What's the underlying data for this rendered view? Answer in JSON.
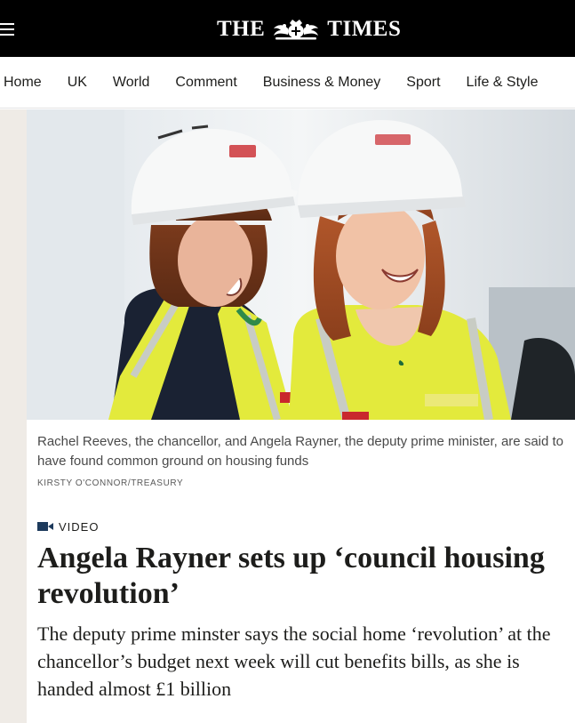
{
  "header": {
    "logo_left": "THE",
    "logo_right": "TIMES",
    "menu_icon": "hamburger-menu-icon",
    "background": "#000000"
  },
  "nav": {
    "items": [
      "Home",
      "UK",
      "World",
      "Comment",
      "Business & Money",
      "Sport",
      "Life & Style"
    ]
  },
  "article": {
    "image": {
      "description_icon": "hero-photo"
    },
    "caption": "Rachel Reeves, the chancellor, and Angela Rayner, the deputy prime minister, are said to have found common ground on housing funds",
    "credit": "KIRSTY O'CONNOR/TREASURY",
    "label": "VIDEO",
    "label_icon": "video-camera-icon",
    "headline": "Angela Rayner sets up ‘council housing revolution’",
    "standfirst": "The deputy prime minster says the social home ‘revolution’ at the chancellor’s budget next week will cut benefits bills, as she is handed almost £1 billion"
  },
  "colors": {
    "side_strip": "#efebe6",
    "hi_vis": "#e3ea3c"
  }
}
